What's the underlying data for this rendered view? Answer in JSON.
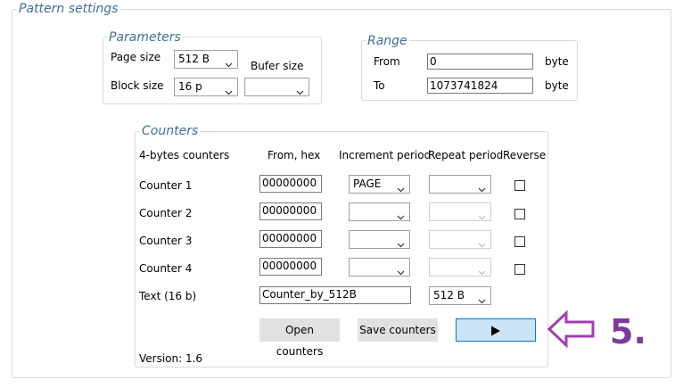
{
  "pattern": {
    "title": "Pattern settings"
  },
  "parameters": {
    "title": "Parameters",
    "page_size_label": "Page size",
    "page_size_value": "512 B",
    "block_size_label": "Block size",
    "block_size_value": "16 p",
    "bufer_size_label": "Bufer size",
    "bufer_size_value": ""
  },
  "range": {
    "title": "Range",
    "from_label": "From",
    "from_value": "0",
    "from_unit": "byte",
    "to_label": "To",
    "to_value": "1073741824",
    "to_unit": "byte"
  },
  "counters": {
    "title": "Counters",
    "headers": {
      "name": "4-bytes counters",
      "from": "From, hex",
      "increment": "Increment period",
      "repeat": "Repeat period",
      "reverse": "Reverse"
    },
    "rows": [
      {
        "label": "Counter 1",
        "from": "00000000",
        "increment": "PAGE",
        "repeat": "",
        "reverse": false
      },
      {
        "label": "Counter 2",
        "from": "00000000",
        "increment": "",
        "repeat": "",
        "reverse": false
      },
      {
        "label": "Counter 3",
        "from": "00000000",
        "increment": "",
        "repeat": "",
        "reverse": false
      },
      {
        "label": "Counter 4",
        "from": "00000000",
        "increment": "",
        "repeat": "",
        "reverse": false
      }
    ],
    "text_label": "Text (16 b)",
    "text_value": "Counter_by_512B",
    "text_size": "512 B",
    "open_label": "Open counters",
    "save_label": "Save counters",
    "run_icon": "play-icon",
    "version": "Version: 1.6"
  },
  "annotation": {
    "step": "5.",
    "color": "#7a3b9d",
    "icon": "arrow-left-outline-icon"
  }
}
